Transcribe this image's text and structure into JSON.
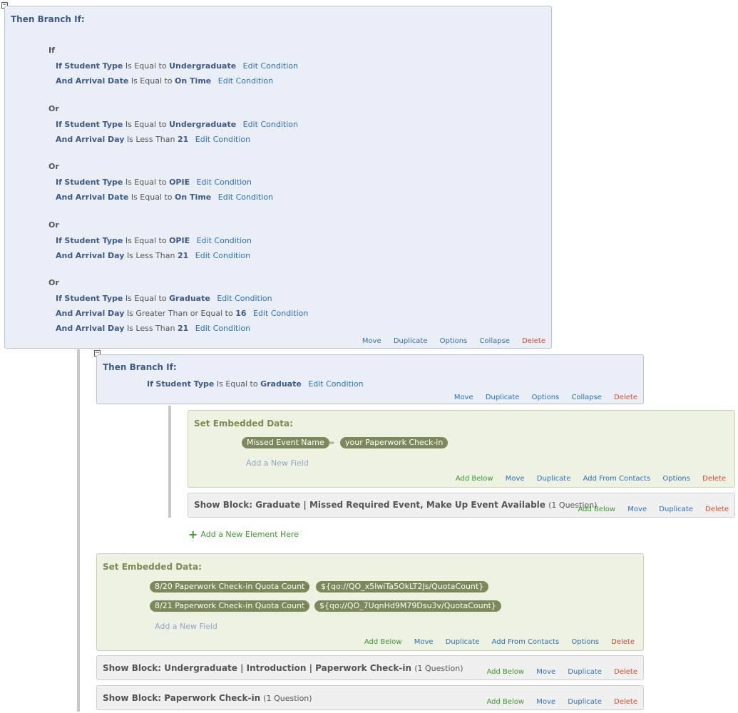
{
  "branch1": {
    "toggle": "−",
    "title": "Then Branch If:",
    "groups": [
      {
        "label": "If",
        "conditions": [
          {
            "conj": "If",
            "field": "Student Type",
            "op": "Is Equal to",
            "value": "Undergraduate",
            "edit": "Edit Condition"
          },
          {
            "conj": "And",
            "field": "Arrival Date",
            "op": "Is Equal to",
            "value": "On Time",
            "edit": "Edit Condition"
          }
        ]
      },
      {
        "label": "Or",
        "conditions": [
          {
            "conj": "If",
            "field": "Student Type",
            "op": "Is Equal to",
            "value": "Undergraduate",
            "edit": "Edit Condition"
          },
          {
            "conj": "And",
            "field": "Arrival Day",
            "op": "Is Less Than",
            "value": "21",
            "edit": "Edit Condition"
          }
        ]
      },
      {
        "label": "Or",
        "conditions": [
          {
            "conj": "If",
            "field": "Student Type",
            "op": "Is Equal to",
            "value": "OPIE",
            "edit": "Edit Condition"
          },
          {
            "conj": "And",
            "field": "Arrival Date",
            "op": "Is Equal to",
            "value": "On Time",
            "edit": "Edit Condition"
          }
        ]
      },
      {
        "label": "Or",
        "conditions": [
          {
            "conj": "If",
            "field": "Student Type",
            "op": "Is Equal to",
            "value": "OPIE",
            "edit": "Edit Condition"
          },
          {
            "conj": "And",
            "field": "Arrival Day",
            "op": "Is Less Than",
            "value": "21",
            "edit": "Edit Condition"
          }
        ]
      },
      {
        "label": "Or",
        "conditions": [
          {
            "conj": "If",
            "field": "Student Type",
            "op": "Is Equal to",
            "value": "Graduate",
            "edit": "Edit Condition"
          },
          {
            "conj": "And",
            "field": "Arrival Day",
            "op": "Is Greater Than or Equal to",
            "value": "16",
            "edit": "Edit Condition"
          },
          {
            "conj": "And",
            "field": "Arrival Day",
            "op": "Is Less Than",
            "value": "21",
            "edit": "Edit Condition"
          }
        ]
      }
    ],
    "actions": {
      "move": "Move",
      "duplicate": "Duplicate",
      "options": "Options",
      "collapse": "Collapse",
      "delete": "Delete"
    }
  },
  "branch2": {
    "toggle": "−",
    "title": "Then Branch If:",
    "condition": {
      "conj": "If",
      "field": "Student Type",
      "op": "Is Equal to",
      "value": "Graduate",
      "edit": "Edit Condition"
    },
    "actions": {
      "move": "Move",
      "duplicate": "Duplicate",
      "options": "Options",
      "collapse": "Collapse",
      "delete": "Delete"
    }
  },
  "embed1": {
    "title": "Set Embedded Data:",
    "fields": [
      {
        "name": "Missed Event Name",
        "eq": "=",
        "value": "your Paperwork Check-in"
      }
    ],
    "add_field": "Add a New Field",
    "actions": {
      "add_below": "Add Below",
      "move": "Move",
      "duplicate": "Duplicate",
      "add_from_contacts": "Add From Contacts",
      "options": "Options",
      "delete": "Delete"
    }
  },
  "show1": {
    "title": "Show Block: Graduate | Missed Required Event, Make Up Event Available",
    "count": "(1 Question)",
    "actions": {
      "add_below": "Add Below",
      "move": "Move",
      "duplicate": "Duplicate",
      "delete": "Delete"
    }
  },
  "add_element": {
    "label": "Add a New Element Here",
    "icon": "+"
  },
  "embed2": {
    "title": "Set Embedded Data:",
    "fields": [
      {
        "name": "8/20 Paperwork Check-in Quota Count",
        "eq": "=",
        "value": "${qo://QO_x5IwiTa5OkLT2Js/QuotaCount}"
      },
      {
        "name": "8/21 Paperwork Check-in Quota Count",
        "eq": "=",
        "value": "${qo://QO_7UqnHd9M79Dsu3v/QuotaCount}"
      }
    ],
    "add_field": "Add a New Field",
    "actions": {
      "add_below": "Add Below",
      "move": "Move",
      "duplicate": "Duplicate",
      "add_from_contacts": "Add From Contacts",
      "options": "Options",
      "delete": "Delete"
    }
  },
  "show2": {
    "title": "Show Block: Undergraduate | Introduction | Paperwork Check-in",
    "count": "(1 Question)",
    "actions": {
      "add_below": "Add Below",
      "move": "Move",
      "duplicate": "Duplicate",
      "delete": "Delete"
    }
  },
  "show3": {
    "title": "Show Block: Paperwork Check-in",
    "count": "(1 Question)",
    "actions": {
      "add_below": "Add Below",
      "move": "Move",
      "duplicate": "Duplicate",
      "delete": "Delete"
    }
  }
}
